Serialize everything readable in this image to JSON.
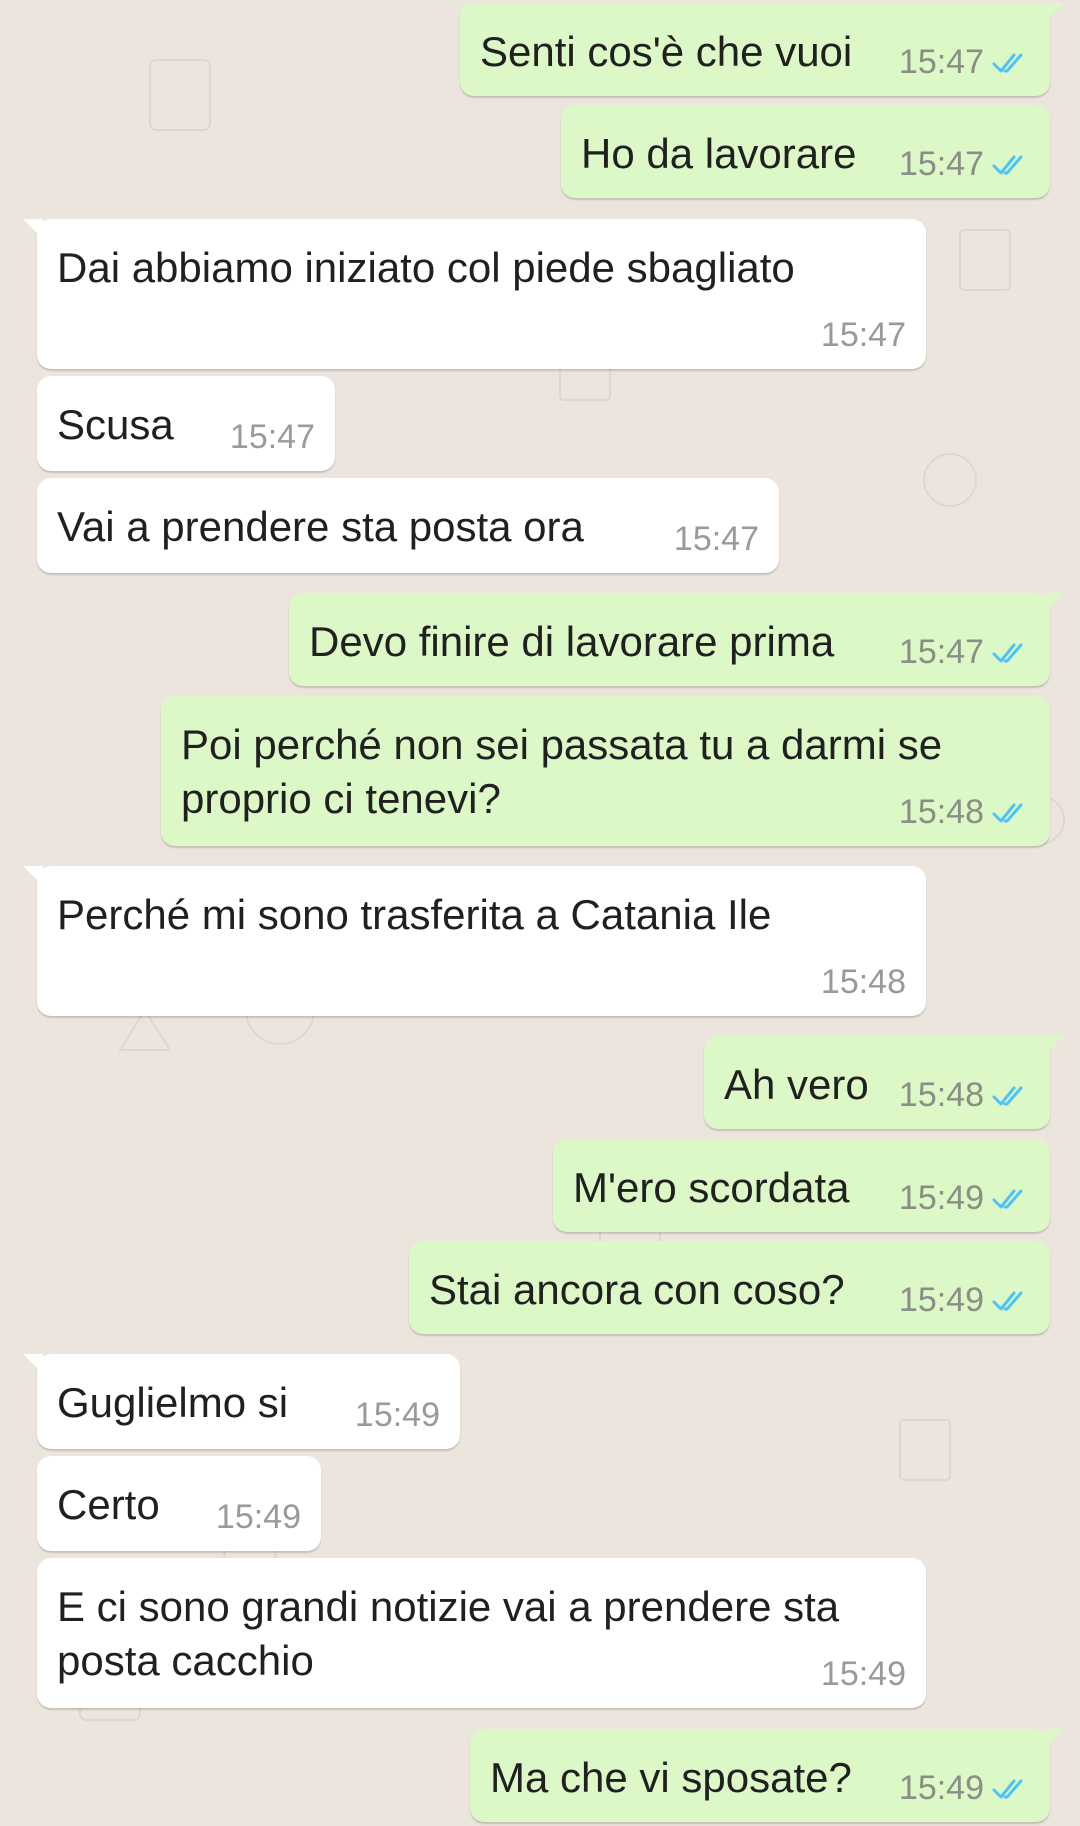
{
  "chat": {
    "messages": [
      {
        "dir": "out",
        "text": "Senti cos'è che vuoi",
        "time": "15:47",
        "status": "read"
      },
      {
        "dir": "out",
        "text": "Ho da lavorare",
        "time": "15:47",
        "status": "read"
      },
      {
        "dir": "in",
        "text": "Dai abbiamo iniziato col piede sbagliato",
        "time": "15:47"
      },
      {
        "dir": "in",
        "text": "Scusa",
        "time": "15:47"
      },
      {
        "dir": "in",
        "text": "Vai a prendere sta posta ora",
        "time": "15:47"
      },
      {
        "dir": "out",
        "text": "Devo finire di lavorare prima",
        "time": "15:47",
        "status": "read"
      },
      {
        "dir": "out",
        "text": "Poi perché non sei passata tu a darmi se proprio ci tenevi?",
        "time": "15:48",
        "status": "read"
      },
      {
        "dir": "in",
        "text": "Perché mi sono trasferita a Catania Ile",
        "time": "15:48"
      },
      {
        "dir": "out",
        "text": "Ah vero",
        "time": "15:48",
        "status": "read"
      },
      {
        "dir": "out",
        "text": "M'ero scordata",
        "time": "15:49",
        "status": "read"
      },
      {
        "dir": "out",
        "text": "Stai ancora con coso?",
        "time": "15:49",
        "status": "read"
      },
      {
        "dir": "in",
        "text": "Guglielmo si",
        "time": "15:49"
      },
      {
        "dir": "in",
        "text": "Certo",
        "time": "15:49"
      },
      {
        "dir": "in",
        "text": "E ci sono grandi notizie vai a prendere sta posta cacchio",
        "time": "15:49"
      },
      {
        "dir": "out",
        "text": "Ma che vi sposate?",
        "time": "15:49",
        "status": "read"
      }
    ]
  },
  "colors": {
    "background": "#ece5dd",
    "outgoing_bubble": "#dcf8c6",
    "incoming_bubble": "#ffffff",
    "read_ticks": "#4fc3f7"
  },
  "icons": {
    "read_receipt": "double-check-icon"
  }
}
